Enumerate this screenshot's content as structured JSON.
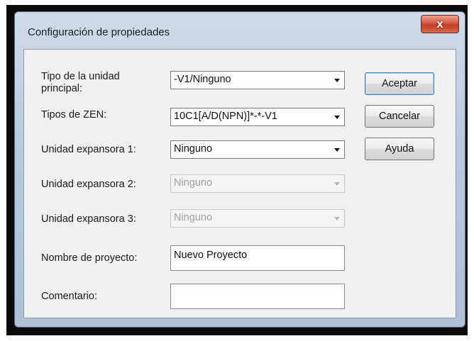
{
  "dialog": {
    "title": "Configuración de propiedades",
    "close_glyph": "x"
  },
  "form": {
    "main_unit_type": {
      "label": "Tipo de la unidad principal:",
      "value": "-V1/Ninguno"
    },
    "zen_types": {
      "label": "Tipos de ZEN:",
      "value": "10C1[A/D(NPN)]*-*-V1"
    },
    "expansion_1": {
      "label": "Unidad expansora 1:",
      "value": "Ninguno"
    },
    "expansion_2": {
      "label": "Unidad expansora 2:",
      "value": "Ninguno"
    },
    "expansion_3": {
      "label": "Unidad expansora 3:",
      "value": "Ninguno"
    },
    "project_name": {
      "label": "Nombre de proyecto:",
      "value": "Nuevo Proyecto"
    },
    "comment": {
      "label": "Comentario:",
      "value": ""
    }
  },
  "buttons": {
    "accept": "Aceptar",
    "cancel": "Cancelar",
    "help": "Ayuda"
  }
}
